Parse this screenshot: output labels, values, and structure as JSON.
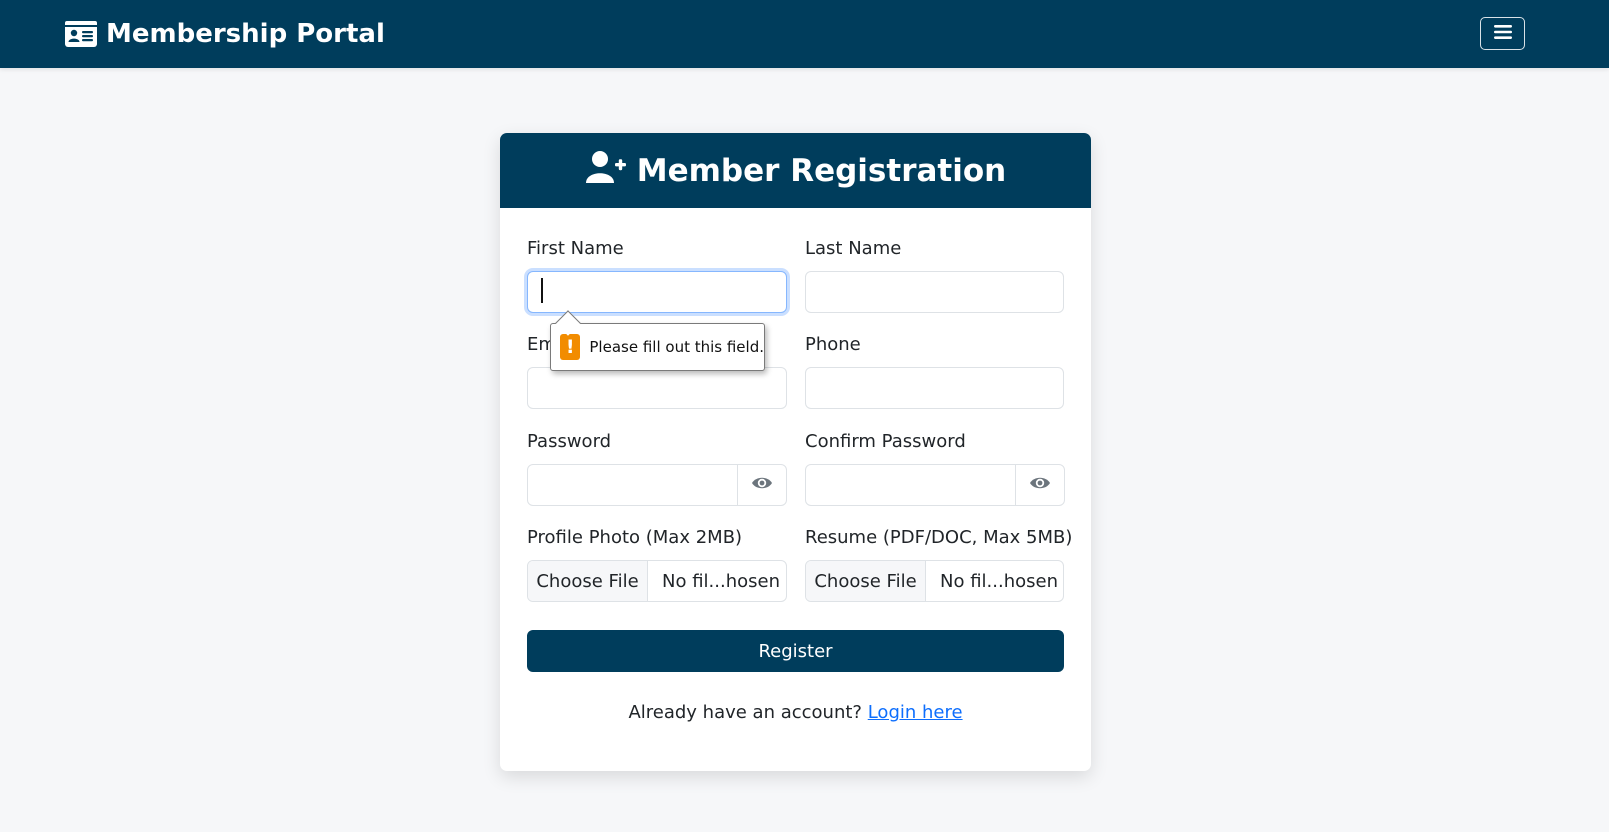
{
  "navbar": {
    "brand_icon": "id-card-icon",
    "brand_title": "Membership Portal",
    "toggler_icon": "hamburger-menu-icon",
    "background": "#003d5c"
  },
  "card": {
    "header_icon": "user-plus-icon",
    "title": "Member Registration",
    "header_background": "#003d5c"
  },
  "form": {
    "first_name": {
      "label": "First Name",
      "value": "",
      "focused": true
    },
    "last_name": {
      "label": "Last Name",
      "value": ""
    },
    "email": {
      "label": "Email",
      "value": ""
    },
    "phone": {
      "label": "Phone",
      "value": ""
    },
    "password": {
      "label": "Password",
      "value": "",
      "toggle_icon": "eye-icon"
    },
    "confirm_password": {
      "label": "Confirm Password",
      "value": "",
      "toggle_icon": "eye-icon"
    },
    "profile_photo": {
      "label": "Profile Photo (Max 2MB)",
      "button_label": "Choose File",
      "file_name": "No fil...hosen"
    },
    "resume": {
      "label": "Resume (PDF/DOC, Max 5MB)",
      "button_label": "Choose File",
      "file_name": "No fil...hosen"
    },
    "register_label": "Register"
  },
  "footer": {
    "prompt": "Already have an account?",
    "login_link": "Login here"
  },
  "validation_tooltip": {
    "icon": "warning-icon",
    "icon_glyph": "!",
    "message": "Please fill out this field.",
    "accent": "#f28c00"
  }
}
